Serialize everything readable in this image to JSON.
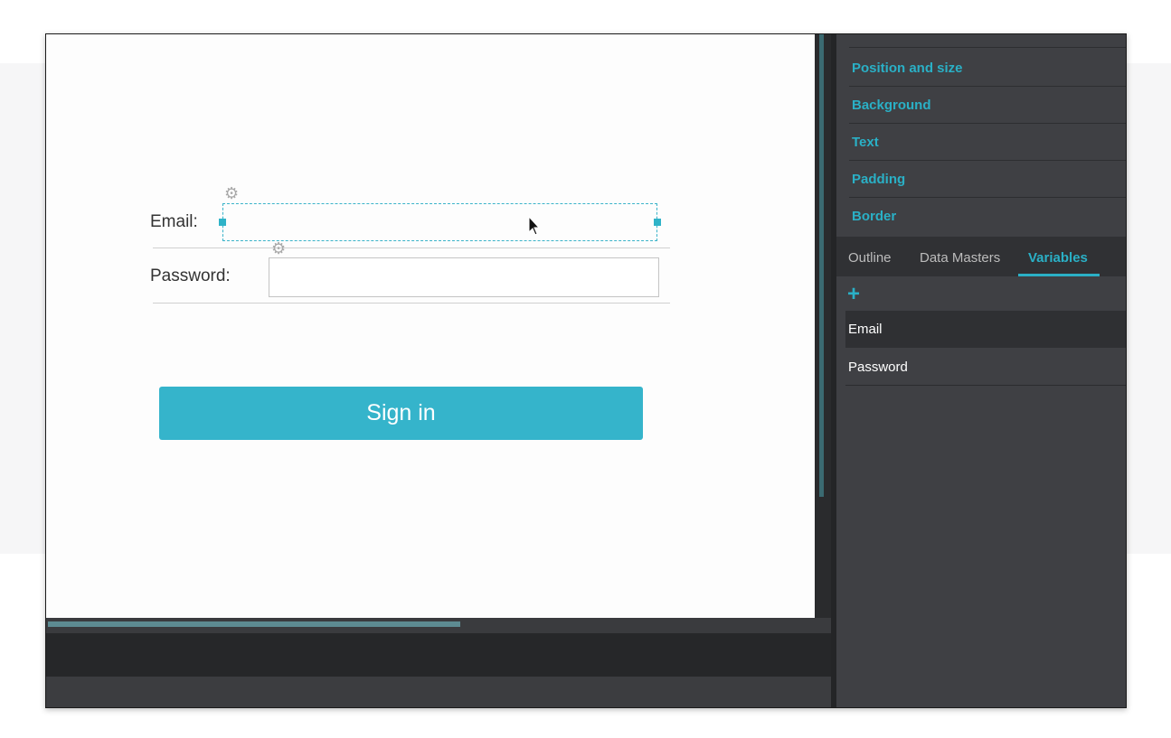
{
  "canvas": {
    "email_label": "Email:",
    "password_label": "Password:",
    "signin_label": "Sign in"
  },
  "properties_panel": {
    "sections": [
      "Position and size",
      "Background",
      "Text",
      "Padding",
      "Border"
    ]
  },
  "tabs": [
    {
      "label": "Outline",
      "active": false
    },
    {
      "label": "Data Masters",
      "active": false
    },
    {
      "label": "Variables",
      "active": true
    }
  ],
  "variables": {
    "add_icon": "plus-icon",
    "items": [
      "Email",
      "Password"
    ],
    "selected": "Email"
  },
  "colors": {
    "accent": "#2ab0c6",
    "button": "#35b4cb",
    "panel": "#3f4044"
  }
}
